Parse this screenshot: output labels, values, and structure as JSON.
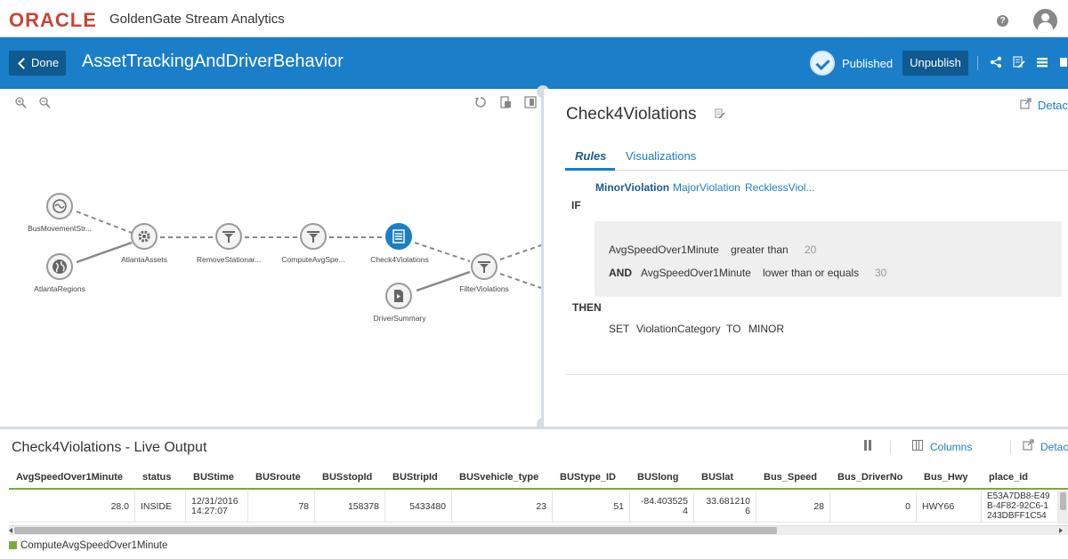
{
  "header": {
    "brand": "ORACLE",
    "brand_sub": "GoldenGate Stream Analytics",
    "help_icon": "help-icon",
    "avatar_icon": "user-avatar-icon"
  },
  "pipeline_bar": {
    "done_label": "Done",
    "title": "AssetTrackingAndDriverBehavior",
    "status": "Published",
    "unpublish_label": "Unpublish"
  },
  "canvas": {
    "nodes": [
      {
        "id": "bus",
        "label": "BusMovementStr...",
        "icon": "stream-icon"
      },
      {
        "id": "regions",
        "label": "AtlantaRegions",
        "icon": "globe-icon"
      },
      {
        "id": "assets",
        "label": "AtlantaAssets",
        "icon": "gear-icon"
      },
      {
        "id": "remove",
        "label": "RemoveStationar...",
        "icon": "filter-icon"
      },
      {
        "id": "compute",
        "label": "ComputeAvgSpe...",
        "icon": "filter-icon"
      },
      {
        "id": "check",
        "label": "Check4Violations",
        "icon": "rules-icon"
      },
      {
        "id": "filterv",
        "label": "FilterViolations",
        "icon": "filter-icon"
      },
      {
        "id": "driver",
        "label": "DriverSummary",
        "icon": "reference-icon"
      }
    ]
  },
  "rule_panel": {
    "title": "Check4Violations",
    "detach_label": "Detach",
    "tabs": [
      {
        "label": "Rules"
      },
      {
        "label": "Visualizations"
      }
    ],
    "rule_tabs": [
      {
        "label": "MinorViolation"
      },
      {
        "label": "MajorViolation"
      },
      {
        "label": "RecklessViol..."
      }
    ],
    "if_label": "IF",
    "conditions": [
      {
        "field": "AvgSpeedOver1Minute",
        "operator": "greater than",
        "value": "20"
      },
      {
        "conjunction": "AND",
        "field": "AvgSpeedOver1Minute",
        "operator": "lower than or equals",
        "value": "30"
      }
    ],
    "then_label": "THEN",
    "action": {
      "set": "SET",
      "field": "ViolationCategory",
      "to": "TO",
      "value": "MINOR"
    }
  },
  "live_output": {
    "title": "Check4Violations - Live Output",
    "columns_label": "Columns",
    "detach_label": "Detach",
    "headers": [
      "AvgSpeedOver1Minute",
      "status",
      "BUStime",
      "BUSroute",
      "BUSstopId",
      "BUStripId",
      "BUSvehicle_type",
      "BUStype_ID",
      "BUSlong",
      "BUSlat",
      "Bus_Speed",
      "Bus_DriverNo",
      "Bus_Hwy",
      "place_id"
    ],
    "row": [
      "28.0",
      "INSIDE",
      "12/31/2016\n14:27:07",
      "78",
      "158378",
      "5433480",
      "23",
      "51",
      "-84.403525\n4",
      "33.681210\n6",
      "28",
      "0",
      "HWY66",
      "E53A7DB8-E49\nB-4F82-92C6-1\n243DBFF1C54\n..."
    ],
    "legend": "ComputeAvgSpeedOver1Minute"
  }
}
